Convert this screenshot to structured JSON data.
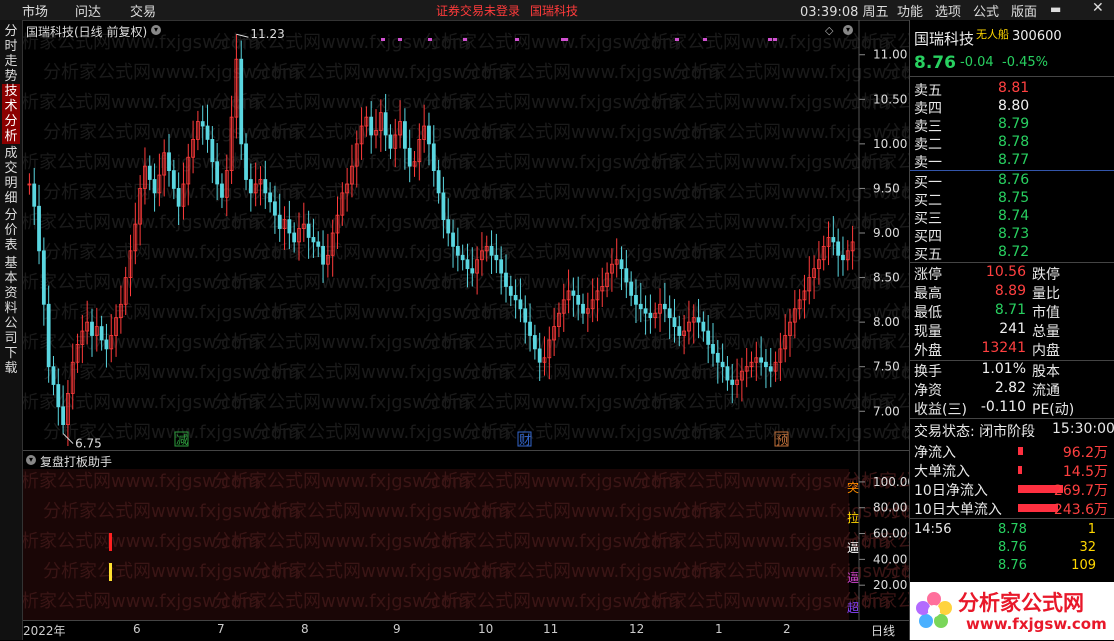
{
  "topbar": {
    "menus": [
      "市场",
      "问达",
      "交易"
    ],
    "warning": "证券交易未登录",
    "warning_name": "国瑞科技",
    "clock": "03:39:08 周五",
    "right_menus": [
      "功能",
      "选项",
      "公式",
      "版面"
    ]
  },
  "left_tabs": [
    "分时走势",
    "技术分析",
    "成交明细",
    "分价表",
    "基本资料",
    "公司下载"
  ],
  "chart": {
    "title": "国瑞科技(日线 前复权)",
    "y_ticks": [
      "11.00",
      "10.50",
      "10.00",
      "9.50",
      "9.00",
      "8.50",
      "8.00",
      "7.50",
      "7.00"
    ],
    "high_label": "11.23",
    "low_label": "6.75",
    "events": [
      {
        "text": "减",
        "color": "#2e9e3e"
      },
      {
        "text": "财",
        "color": "#3366cc"
      },
      {
        "text": "预",
        "color": "#c0703a"
      }
    ],
    "x_labels": [
      "2022年",
      "6",
      "7",
      "8",
      "9",
      "10",
      "11",
      "12",
      "1",
      "2"
    ],
    "period_label": "日线"
  },
  "chart_data": {
    "type": "candlestick",
    "ylim": [
      6.7,
      11.3
    ],
    "high": 11.23,
    "low": 6.75,
    "closes": [
      9.55,
      9.3,
      8.8,
      8.2,
      7.5,
      7.3,
      7.05,
      6.85,
      7.2,
      7.55,
      7.75,
      7.9,
      8.0,
      7.85,
      7.95,
      7.8,
      7.7,
      7.85,
      8.05,
      8.2,
      8.5,
      8.8,
      9.1,
      9.5,
      9.75,
      9.6,
      9.45,
      9.65,
      9.9,
      9.7,
      9.5,
      9.3,
      9.55,
      9.85,
      10.05,
      10.25,
      10.2,
      10.05,
      9.8,
      9.55,
      9.4,
      9.7,
      10.3,
      10.95,
      10.0,
      9.6,
      9.45,
      9.55,
      9.6,
      9.45,
      9.35,
      9.2,
      9.05,
      9.15,
      9.0,
      8.9,
      9.05,
      9.1,
      8.95,
      8.9,
      8.85,
      8.65,
      8.75,
      9.0,
      9.2,
      9.45,
      9.55,
      9.75,
      10.0,
      10.2,
      10.3,
      10.1,
      10.15,
      10.35,
      10.1,
      9.95,
      10.1,
      10.25,
      9.95,
      9.75,
      9.8,
      10.05,
      10.2,
      10.0,
      9.7,
      9.45,
      9.15,
      9.0,
      8.85,
      8.75,
      8.7,
      8.6,
      8.55,
      8.7,
      8.8,
      8.85,
      8.75,
      8.7,
      8.55,
      8.4,
      8.3,
      8.25,
      8.15,
      8.0,
      7.85,
      7.7,
      7.55,
      7.6,
      7.8,
      7.95,
      8.1,
      8.25,
      8.35,
      8.3,
      8.2,
      8.1,
      8.15,
      8.25,
      8.35,
      8.4,
      8.55,
      8.65,
      8.7,
      8.6,
      8.45,
      8.3,
      8.2,
      8.15,
      8.1,
      8.05,
      8.1,
      8.2,
      8.15,
      8.05,
      7.95,
      7.85,
      7.9,
      8.0,
      8.05,
      8.0,
      7.9,
      7.75,
      7.65,
      7.55,
      7.5,
      7.35,
      7.3,
      7.35,
      7.45,
      7.5,
      7.55,
      7.6,
      7.55,
      7.5,
      7.45,
      7.55,
      7.7,
      7.85,
      8.0,
      8.15,
      8.25,
      8.35,
      8.5,
      8.6,
      8.7,
      8.85,
      8.95,
      8.9,
      8.75,
      8.7,
      8.8,
      8.9
    ]
  },
  "indicator": {
    "title": "复盘打板助手",
    "y_ticks": [
      "100.00",
      "80.00",
      "60.00",
      "40.00",
      "20.00"
    ],
    "right_marks": [
      {
        "text": "突",
        "color": "#ff8c00"
      },
      {
        "text": "拉",
        "color": "#ffd700"
      },
      {
        "text": "逼",
        "color": "#ffffff"
      },
      {
        "text": "逼",
        "color": "#cc44cc"
      },
      {
        "text": "超",
        "color": "#8844ff"
      }
    ]
  },
  "quote": {
    "name": "国瑞科技",
    "tag": "无人船",
    "code": "300600",
    "price": "8.76",
    "change": "-0.04",
    "pct": "-0.45%",
    "asks": [
      {
        "label": "卖五",
        "price": "8.81",
        "color": "red"
      },
      {
        "label": "卖四",
        "price": "8.80",
        "color": "white"
      },
      {
        "label": "卖三",
        "price": "8.79",
        "color": "green"
      },
      {
        "label": "卖二",
        "price": "8.78",
        "color": "green"
      },
      {
        "label": "卖一",
        "price": "8.77",
        "color": "green"
      }
    ],
    "bids": [
      {
        "label": "买一",
        "price": "8.76",
        "color": "green"
      },
      {
        "label": "买二",
        "price": "8.75",
        "color": "green"
      },
      {
        "label": "买三",
        "price": "8.74",
        "color": "green"
      },
      {
        "label": "买四",
        "price": "8.73",
        "color": "green"
      },
      {
        "label": "买五",
        "price": "8.72",
        "color": "green"
      }
    ],
    "stats": [
      {
        "l": "涨停",
        "v": "10.56",
        "c": "red",
        "r": "跌停"
      },
      {
        "l": "最高",
        "v": "8.89",
        "c": "red",
        "r": "量比"
      },
      {
        "l": "最低",
        "v": "8.71",
        "c": "green",
        "r": "市值"
      },
      {
        "l": "现量",
        "v": "241",
        "c": "white",
        "r": "总量"
      },
      {
        "l": "外盘",
        "v": "13241",
        "c": "red",
        "r": "内盘"
      },
      {
        "l": "换手",
        "v": "1.01%",
        "c": "white",
        "r": "股本"
      },
      {
        "l": "净资",
        "v": "2.82",
        "c": "white",
        "r": "流通"
      },
      {
        "l": "收益(三)",
        "v": "-0.110",
        "c": "white",
        "r": "PE(动)"
      }
    ],
    "status_label": "交易状态: 闭市阶段",
    "status_time": "15:30:00",
    "flows": [
      {
        "l": "净流入",
        "v": "96.2万",
        "bar": 0.1
      },
      {
        "l": "大单流入",
        "v": "14.5万",
        "bar": 0.05
      },
      {
        "l": "10日净流入",
        "v": "269.7万",
        "bar": 0.9
      },
      {
        "l": "10日大单流入",
        "v": "243.6万",
        "bar": 0.8
      }
    ],
    "ticks": [
      {
        "t": "14:56",
        "p": "8.78",
        "v": "1",
        "vc": "yel"
      },
      {
        "t": "",
        "p": "8.76",
        "v": "32",
        "vc": "yel"
      },
      {
        "t": "",
        "p": "8.76",
        "v": "109",
        "vc": "yel"
      }
    ]
  },
  "watermark": "分析家公式网",
  "watermark_url": "www.fxjgsw.com",
  "colors": {
    "up": "#ff3b3b",
    "down": "#5ad6e0",
    "bg": "#000000"
  }
}
